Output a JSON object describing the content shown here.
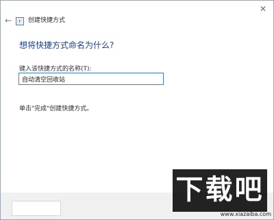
{
  "window": {
    "title": "创建快捷方式",
    "app_icon_glyph": "r"
  },
  "icons": {
    "back": "back-arrow-icon",
    "close": "close-icon",
    "app": "shortcut-wizard-icon"
  },
  "page": {
    "heading": "想将快捷方式命名为什么?",
    "field_label": "键入该快捷方式的名称(T):",
    "name_value": "自动清空回收站",
    "instruction": "单击\"完成\"创建快捷方式。"
  },
  "watermark": {
    "logo_text": "下载吧",
    "url": "www.xiazaiba.com"
  },
  "colors": {
    "heading": "#1f3f8f",
    "input_border": "#3c7fc4",
    "footer_bg": "#f0f0f0"
  }
}
